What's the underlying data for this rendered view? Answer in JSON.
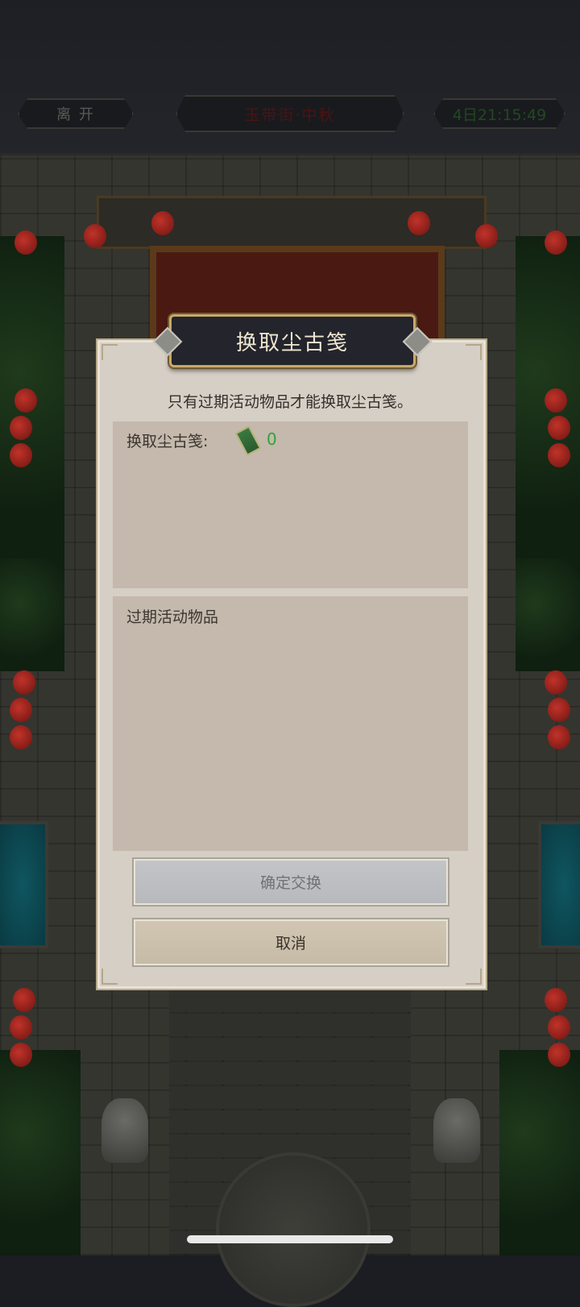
{
  "top_bar": {
    "leave_label": "离 开",
    "location_label": "玉带街·中秋",
    "time_label": "4日21:15:49"
  },
  "dialog": {
    "title": "换取尘古笺",
    "notice": "只有过期活动物品才能换取尘古笺。",
    "exchange_panel": {
      "label": "换取尘古笺:",
      "item_icon": "green-token-icon",
      "count": "0"
    },
    "expired_panel": {
      "label": "过期活动物品"
    },
    "confirm_label": "确定交换",
    "cancel_label": "取消"
  },
  "colors": {
    "count_green": "#2fa33a",
    "title_gold": "#c7a96a",
    "dialog_bg": "#d6cfc6",
    "panel_bg": "#c4b9ac"
  }
}
